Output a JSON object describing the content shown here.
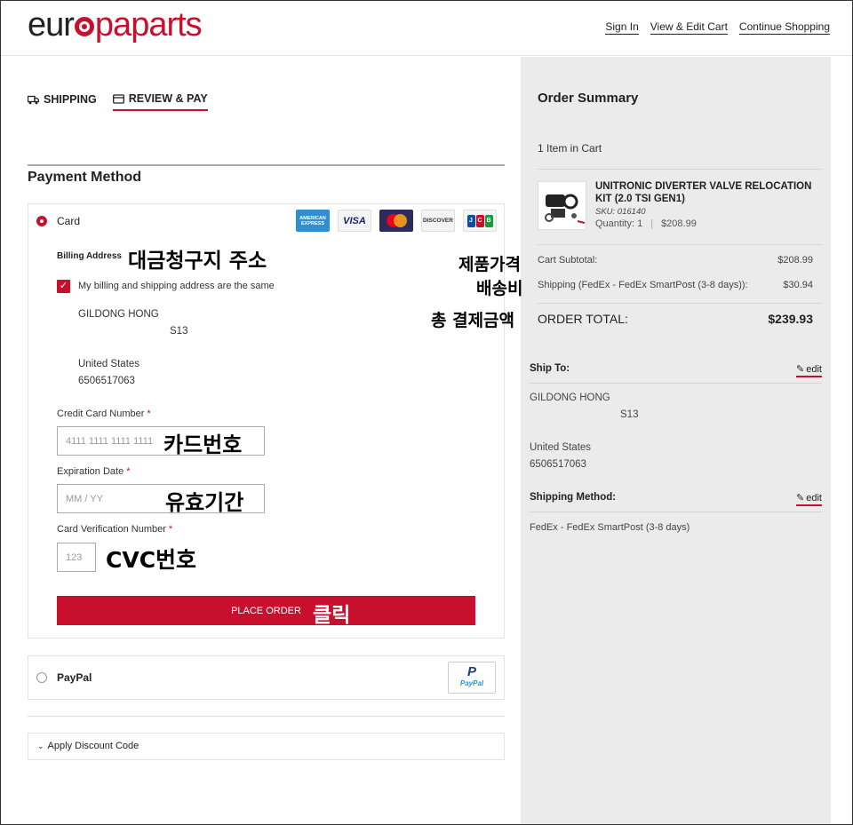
{
  "header": {
    "logo_part1": "eur",
    "logo_part2": "pa",
    "logo_part3": "parts",
    "links": [
      "Sign In",
      "View & Edit Cart",
      "Continue Shopping"
    ]
  },
  "steps": [
    {
      "label": "SHIPPING",
      "icon": "truck-icon"
    },
    {
      "label": "REVIEW & PAY",
      "icon": "credit-card-icon"
    }
  ],
  "payment": {
    "title": "Payment Method",
    "card_label": "Card",
    "card_icons": {
      "amex": "AMERICAN EXPRESS",
      "visa": "VISA",
      "discover": "DISCOVER",
      "jcb": [
        "J",
        "C",
        "B"
      ]
    },
    "billing_label": "Billing Address",
    "same_address_label": "My billing and shipping address are the same",
    "billing_name": "GILDONG HONG",
    "billing_line2": "S13",
    "billing_country": "United States",
    "billing_phone": "6506517063",
    "cc_label": "Credit Card Number",
    "cc_value": "4111 1111 1111 1111",
    "exp_label": "Expiration Date",
    "exp_placeholder": "MM / YY",
    "cvv_label": "Card Verification Number",
    "cvv_placeholder": "123",
    "required_mark": "*",
    "place_order": "PLACE ORDER",
    "paypal_label": "PayPal",
    "paypal_logo": "P",
    "paypal_logo_text": "PayPal",
    "discount_label": "Apply Discount Code"
  },
  "annotations": {
    "billing_address": "대금청구지 주소",
    "product_price": "제품가격",
    "shipping_fee": "배송비",
    "total_payment": "총 결제금액",
    "card_number": "카드번호",
    "expiry": "유효기간",
    "cvc": "CVC번호",
    "click": "클릭"
  },
  "summary": {
    "title": "Order Summary",
    "item_count": "1 Item in Cart",
    "product_name": "UNITRONIC DIVERTER VALVE RELOCATION KIT (2.0 TSI GEN1)",
    "sku": "SKU: 016140",
    "quantity": "Quantity: 1",
    "price": "$208.99",
    "subtotal_label": "Cart Subtotal:",
    "subtotal": "$208.99",
    "shipping_label": "Shipping (FedEx - FedEx SmartPost (3-8 days)):",
    "shipping": "$30.94",
    "total_label": "ORDER TOTAL:",
    "total": "$239.93"
  },
  "ship_to": {
    "title": "Ship To:",
    "edit": "edit",
    "name": "GILDONG HONG",
    "line2": "S13",
    "country": "United States",
    "phone": "6506517063"
  },
  "shipping_method": {
    "title": "Shipping Method:",
    "edit": "edit",
    "value": "FedEx - FedEx SmartPost (3-8 days)"
  },
  "colors": {
    "brand": "#c8102e",
    "panel": "#ebebeb"
  }
}
